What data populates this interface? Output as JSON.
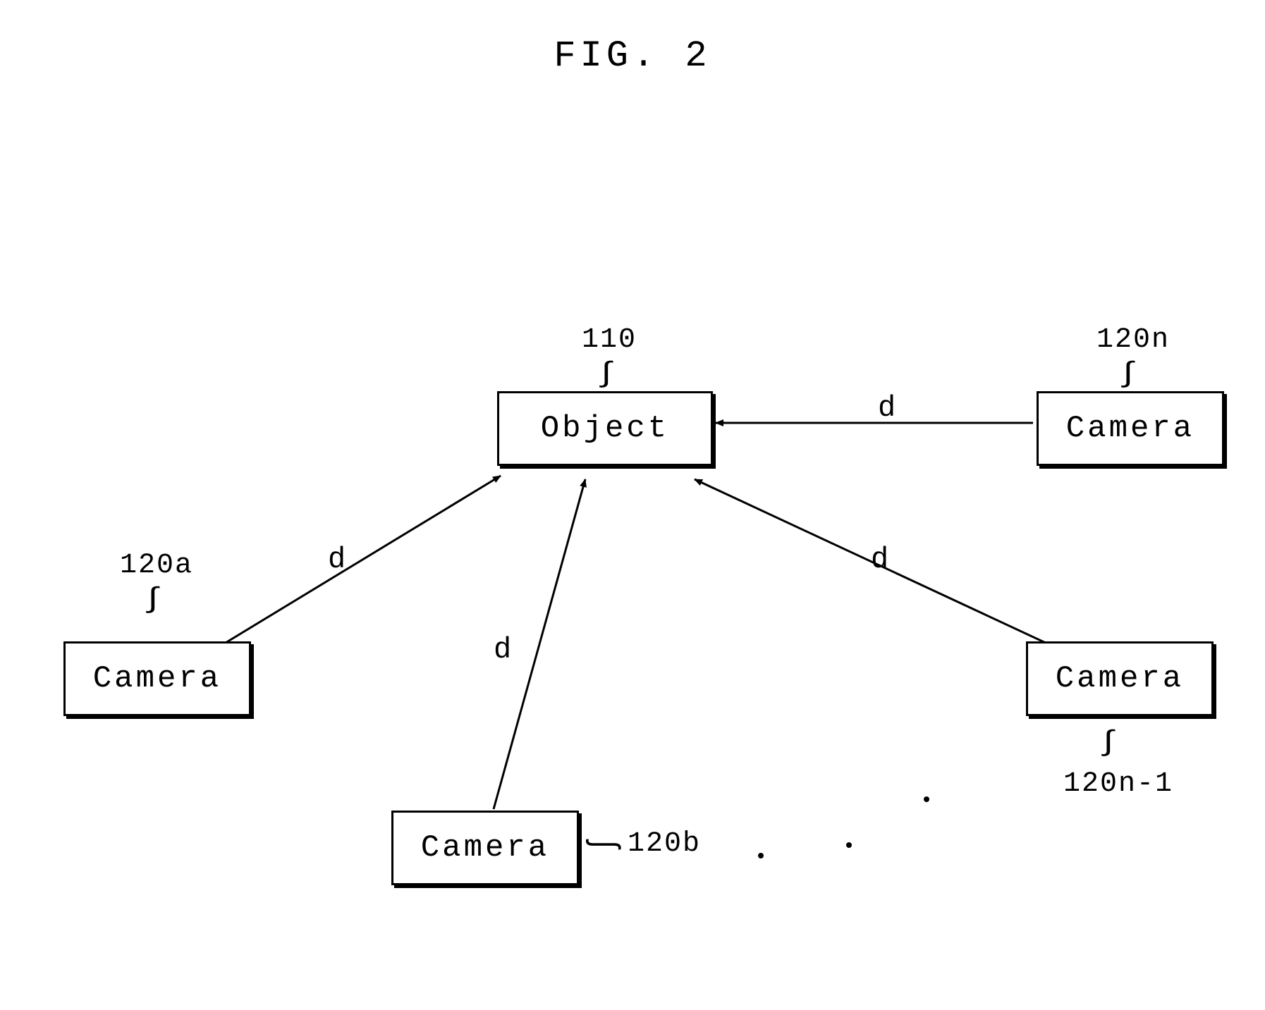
{
  "figure": {
    "title": "FIG. 2",
    "object": {
      "label": "Object",
      "ref": "110"
    },
    "cameras": {
      "a": {
        "label": "Camera",
        "ref": "120a",
        "distance": "d"
      },
      "b": {
        "label": "Camera",
        "ref": "120b",
        "distance": "d"
      },
      "nminus1": {
        "label": "Camera",
        "ref": "120n-1",
        "distance": "d"
      },
      "n": {
        "label": "Camera",
        "ref": "120n",
        "distance": "d"
      }
    },
    "squiggle": "∫"
  }
}
